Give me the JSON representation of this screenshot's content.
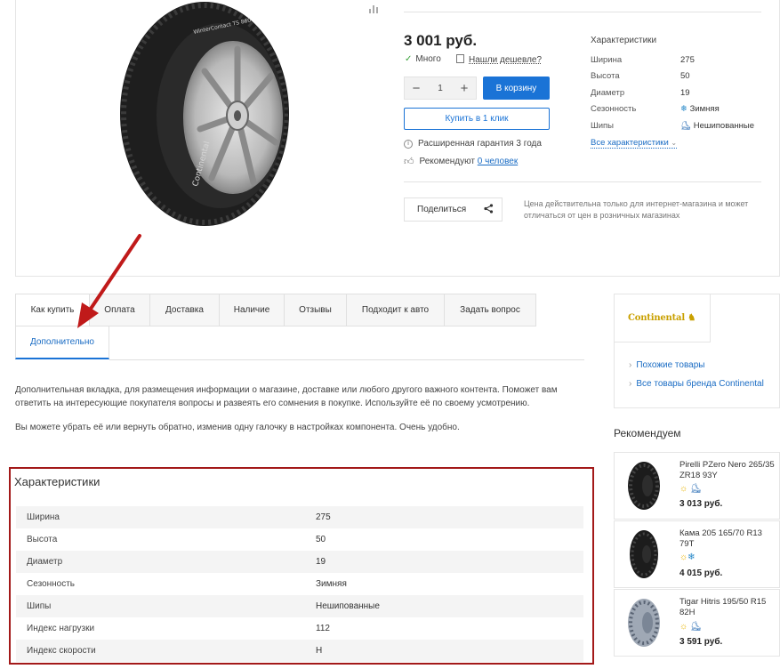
{
  "product": {
    "price": "3 001 руб.",
    "stock": "Много",
    "cheaper_link": "Нашли дешевле?",
    "quantity": "1",
    "qty_minus": "−",
    "qty_plus": "+",
    "cart_button": "В корзину",
    "one_click_button": "Купить в 1 клик",
    "warranty": "Расширенная гарантия 3 года",
    "recommend_prefix": "Рекомендуют",
    "recommend_link": "0 человек",
    "share_button": "Поделиться",
    "price_note": "Цена действительна только для интернет-магазина и может отличаться от цен в розничных магазинах",
    "brand_on_tire": "Continental",
    "model_on_tire": "WinterContact TS 860"
  },
  "short_chars": {
    "title": "Характеристики",
    "rows": [
      {
        "k": "Ширина",
        "v": "275"
      },
      {
        "k": "Высота",
        "v": "50"
      },
      {
        "k": "Диаметр",
        "v": "19"
      },
      {
        "k": "Сезонность",
        "v": "Зимняя",
        "icon": "snowflake-icon"
      },
      {
        "k": "Шипы",
        "v": "Нешипованные",
        "icon": "spike-icon"
      }
    ],
    "all_link": "Все характеристики"
  },
  "tabs": {
    "items": [
      "Как купить",
      "Оплата",
      "Доставка",
      "Наличие",
      "Отзывы",
      "Подходит к авто",
      "Задать вопрос"
    ],
    "active": "Дополнительно"
  },
  "description": {
    "p1": "Дополнительная вкладка, для размещения информации о магазине, доставке или любого другого важного контента. Поможет вам ответить на интересующие покупателя вопросы и развеять его сомнения в покупке. Используйте её по своему усмотрению.",
    "p2": "Вы можете убрать её или вернуть обратно, изменив одну галочку в настройках компонента. Очень удобно."
  },
  "full_chars": {
    "title": "Характеристики",
    "rows": [
      {
        "k": "Ширина",
        "v": "275"
      },
      {
        "k": "Высота",
        "v": "50"
      },
      {
        "k": "Диаметр",
        "v": "19"
      },
      {
        "k": "Сезонность",
        "v": "Зимняя"
      },
      {
        "k": "Шипы",
        "v": "Нешипованные"
      },
      {
        "k": "Индекс нагрузки",
        "v": "112"
      },
      {
        "k": "Индекс скорости",
        "v": "H"
      }
    ]
  },
  "sidebar": {
    "brand_logo": "ntinental",
    "links": [
      "Похожие товары",
      "Все товары бренда Continental"
    ],
    "rec_title": "Рекомендуем",
    "recs": [
      {
        "name": "Pirelli PZero Nero 265/35 ZR18 93Y",
        "price": "3 013 руб."
      },
      {
        "name": "Кама 205 165/70 R13 79T",
        "price": "4 015 руб."
      },
      {
        "name": "Tigar Hitris 195/50 R15 82H",
        "price": "3 591 руб."
      }
    ]
  },
  "colors": {
    "accent": "#1a73d6",
    "highlight_border": "#a31919",
    "arrow": "#c01a1a",
    "brand": "#c9a000"
  }
}
